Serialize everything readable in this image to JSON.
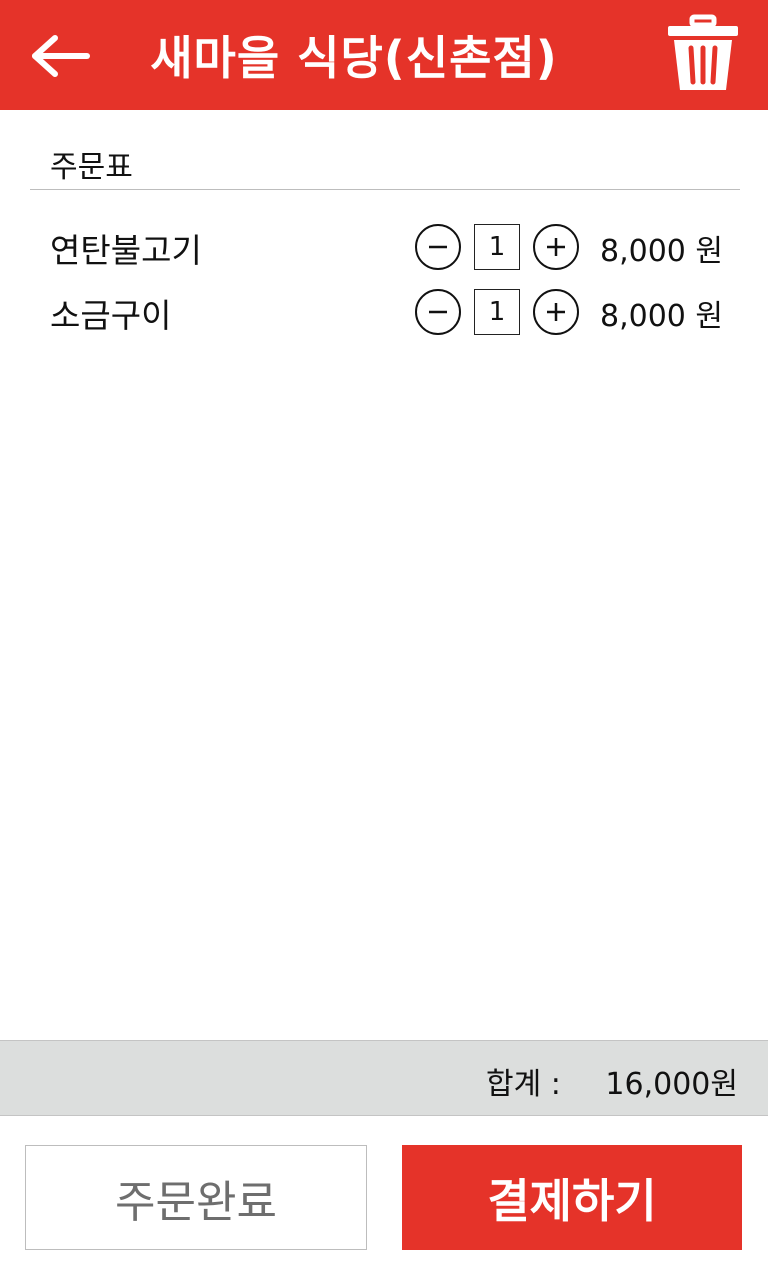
{
  "header": {
    "title": "새마을 식당(신촌점)",
    "back_icon": "arrow-left-icon",
    "trash_icon": "trash-icon",
    "color": "#e53329"
  },
  "order": {
    "section_title": "주문표",
    "items": [
      {
        "name": "연탄불고기",
        "quantity": "1",
        "price": "8,000 원"
      },
      {
        "name": "소금구이",
        "quantity": "1",
        "price": "8,000 원"
      }
    ],
    "minus_icon": "minus-circle-icon",
    "plus_icon": "plus-circle-icon"
  },
  "total": {
    "label": "합계 :",
    "value": "16,000원"
  },
  "actions": {
    "complete_label": "주문완료",
    "pay_label": "결제하기",
    "pay_color": "#e53329"
  }
}
